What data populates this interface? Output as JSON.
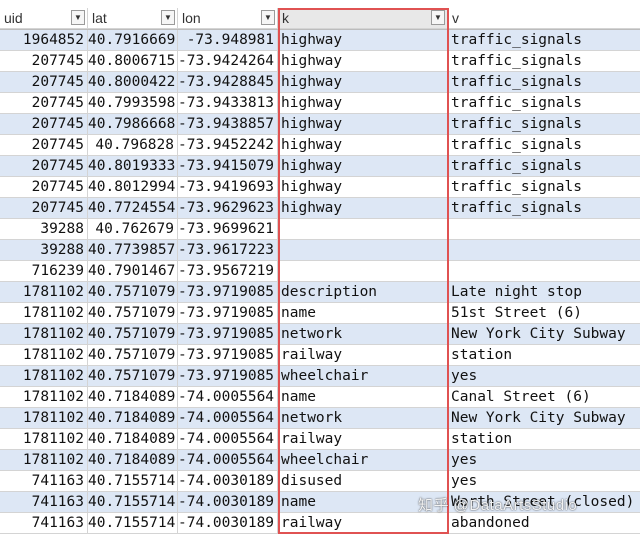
{
  "columns": [
    {
      "key": "uid",
      "label": "uid"
    },
    {
      "key": "lat",
      "label": "lat"
    },
    {
      "key": "lon",
      "label": "lon"
    },
    {
      "key": "k",
      "label": "k"
    },
    {
      "key": "v",
      "label": "v"
    }
  ],
  "filter_icon": "dropdown-arrow-icon",
  "rows": [
    {
      "uid": "1964852",
      "lat": "40.7916669",
      "lon": "-73.948981",
      "k": "highway",
      "v": "traffic_signals"
    },
    {
      "uid": "207745",
      "lat": "40.8006715",
      "lon": "-73.9424264",
      "k": "highway",
      "v": "traffic_signals"
    },
    {
      "uid": "207745",
      "lat": "40.8000422",
      "lon": "-73.9428845",
      "k": "highway",
      "v": "traffic_signals"
    },
    {
      "uid": "207745",
      "lat": "40.7993598",
      "lon": "-73.9433813",
      "k": "highway",
      "v": "traffic_signals"
    },
    {
      "uid": "207745",
      "lat": "40.7986668",
      "lon": "-73.9438857",
      "k": "highway",
      "v": "traffic_signals"
    },
    {
      "uid": "207745",
      "lat": "40.796828",
      "lon": "-73.9452242",
      "k": "highway",
      "v": "traffic_signals"
    },
    {
      "uid": "207745",
      "lat": "40.8019333",
      "lon": "-73.9415079",
      "k": "highway",
      "v": "traffic_signals"
    },
    {
      "uid": "207745",
      "lat": "40.8012994",
      "lon": "-73.9419693",
      "k": "highway",
      "v": "traffic_signals"
    },
    {
      "uid": "207745",
      "lat": "40.7724554",
      "lon": "-73.9629623",
      "k": "highway",
      "v": "traffic_signals"
    },
    {
      "uid": "39288",
      "lat": "40.762679",
      "lon": "-73.9699621",
      "k": "",
      "v": ""
    },
    {
      "uid": "39288",
      "lat": "40.7739857",
      "lon": "-73.9617223",
      "k": "",
      "v": ""
    },
    {
      "uid": "716239",
      "lat": "40.7901467",
      "lon": "-73.9567219",
      "k": "",
      "v": ""
    },
    {
      "uid": "1781102",
      "lat": "40.7571079",
      "lon": "-73.9719085",
      "k": "description",
      "v": "Late night stop"
    },
    {
      "uid": "1781102",
      "lat": "40.7571079",
      "lon": "-73.9719085",
      "k": "name",
      "v": "51st Street (6)"
    },
    {
      "uid": "1781102",
      "lat": "40.7571079",
      "lon": "-73.9719085",
      "k": "network",
      "v": "New York City Subway"
    },
    {
      "uid": "1781102",
      "lat": "40.7571079",
      "lon": "-73.9719085",
      "k": "railway",
      "v": "station"
    },
    {
      "uid": "1781102",
      "lat": "40.7571079",
      "lon": "-73.9719085",
      "k": "wheelchair",
      "v": "yes"
    },
    {
      "uid": "1781102",
      "lat": "40.7184089",
      "lon": "-74.0005564",
      "k": "name",
      "v": "Canal Street (6)"
    },
    {
      "uid": "1781102",
      "lat": "40.7184089",
      "lon": "-74.0005564",
      "k": "network",
      "v": "New York City Subway"
    },
    {
      "uid": "1781102",
      "lat": "40.7184089",
      "lon": "-74.0005564",
      "k": "railway",
      "v": "station"
    },
    {
      "uid": "1781102",
      "lat": "40.7184089",
      "lon": "-74.0005564",
      "k": "wheelchair",
      "v": "yes"
    },
    {
      "uid": "741163",
      "lat": "40.7155714",
      "lon": "-74.0030189",
      "k": "disused",
      "v": "yes"
    },
    {
      "uid": "741163",
      "lat": "40.7155714",
      "lon": "-74.0030189",
      "k": "name",
      "v": "Worth Street (closed)"
    },
    {
      "uid": "741163",
      "lat": "40.7155714",
      "lon": "-74.0030189",
      "k": "railway",
      "v": "abandoned"
    }
  ],
  "watermark": "知乎 @DataArtsStudio",
  "colors": {
    "band": "#dde7f5",
    "highlight_border": "#e05252"
  }
}
